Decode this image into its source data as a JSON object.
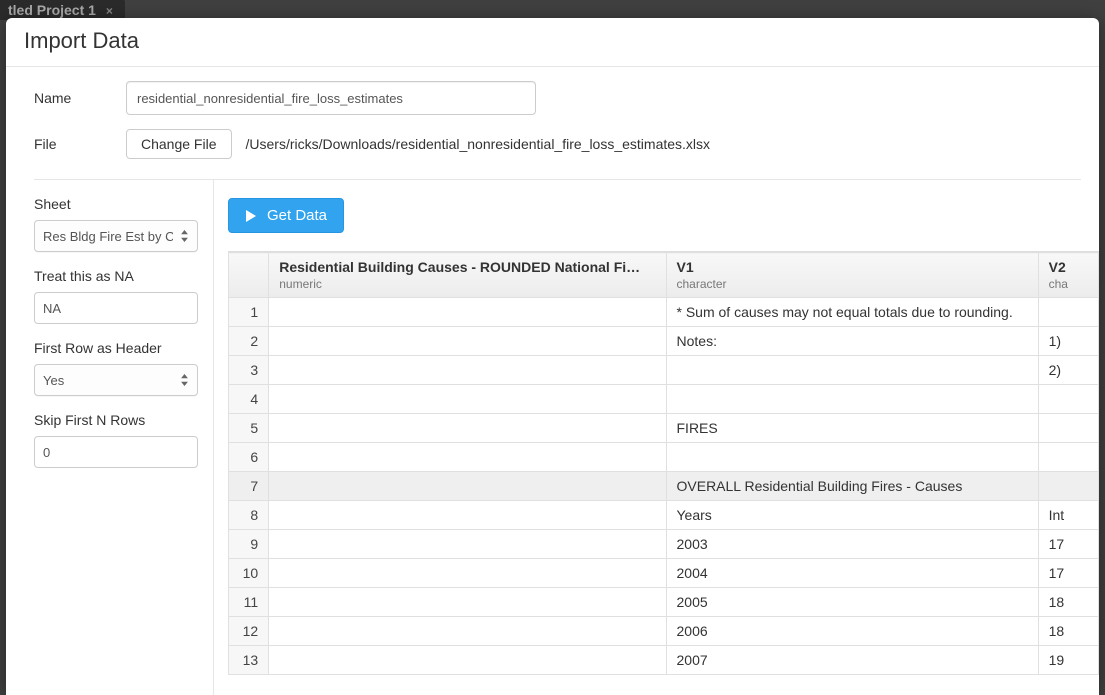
{
  "backdrop": {
    "tab_label": "tled Project 1",
    "tab_close": "×"
  },
  "dialog": {
    "title": "Import Data",
    "name_label": "Name",
    "name_value": "residential_nonresidential_fire_loss_estimates",
    "file_label": "File",
    "change_file_label": "Change File",
    "file_path": "/Users/ricks/Downloads/residential_nonresidential_fire_loss_estimates.xlsx"
  },
  "options": {
    "sheet_label": "Sheet",
    "sheet_value": "Res Bldg Fire Est by Cau",
    "na_label": "Treat this as NA",
    "na_value": "NA",
    "header_label": "First Row as Header",
    "header_value": "Yes",
    "skip_label": "Skip First N Rows",
    "skip_value": "0"
  },
  "preview": {
    "get_data_label": "Get Data",
    "columns": [
      {
        "name": "Residential Building Causes - ROUNDED National Fi…",
        "type": "numeric"
      },
      {
        "name": "V1",
        "type": "character"
      },
      {
        "name": "V2",
        "type": "cha"
      }
    ],
    "rows": [
      {
        "n": "1",
        "c0": "",
        "c1": "* Sum of causes may not equal totals due to rounding.",
        "c2": ""
      },
      {
        "n": "2",
        "c0": "",
        "c1": "Notes:",
        "c2": "1)"
      },
      {
        "n": "3",
        "c0": "",
        "c1": "",
        "c2": "2)"
      },
      {
        "n": "4",
        "c0": "",
        "c1": "",
        "c2": ""
      },
      {
        "n": "5",
        "c0": "",
        "c1": "FIRES",
        "c2": ""
      },
      {
        "n": "6",
        "c0": "",
        "c1": "",
        "c2": ""
      },
      {
        "n": "7",
        "c0": "",
        "c1": "OVERALL Residential Building Fires - Causes",
        "c2": "",
        "sel": true
      },
      {
        "n": "8",
        "c0": "",
        "c1": "Years",
        "c2": "Int"
      },
      {
        "n": "9",
        "c0": "",
        "c1": "2003",
        "c2": "17"
      },
      {
        "n": "10",
        "c0": "",
        "c1": "2004",
        "c2": "17"
      },
      {
        "n": "11",
        "c0": "",
        "c1": "2005",
        "c2": "18"
      },
      {
        "n": "12",
        "c0": "",
        "c1": "2006",
        "c2": "18"
      },
      {
        "n": "13",
        "c0": "",
        "c1": "2007",
        "c2": "19"
      }
    ]
  }
}
